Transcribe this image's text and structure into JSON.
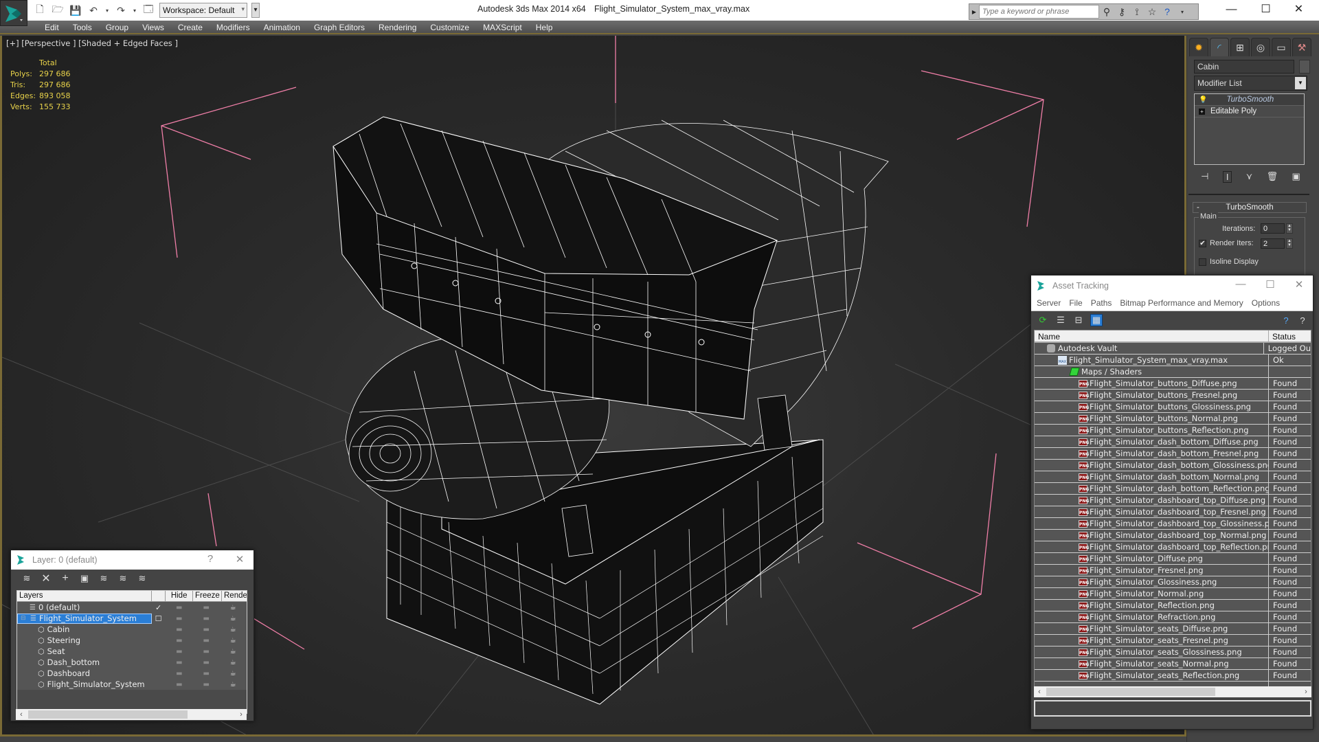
{
  "titlebar": {
    "app_title": "Autodesk 3ds Max  2014 x64",
    "file_name": "Flight_Simulator_System_max_vray.max",
    "workspace": "Workspace: Default",
    "search_placeholder": "Type a keyword or phrase",
    "icons": [
      "new-file-icon",
      "open-folder-icon",
      "save-icon",
      "undo-icon",
      "redo-icon",
      "project-folder-icon"
    ],
    "search_icons": [
      "binoculars-icon",
      "key-icon",
      "satellite-icon",
      "star-icon",
      "help-icon"
    ],
    "controls": {
      "minimize": "—",
      "maximize": "☐",
      "close": "✕"
    }
  },
  "menubar": {
    "items": [
      "Edit",
      "Tools",
      "Group",
      "Views",
      "Create",
      "Modifiers",
      "Animation",
      "Graph Editors",
      "Rendering",
      "Customize",
      "MAXScript",
      "Help"
    ]
  },
  "viewport": {
    "label": "[+] [Perspective ] [Shaded + Edged Faces ]",
    "stats": {
      "header": "Total",
      "rows": [
        {
          "label": "Polys:",
          "value": "297 686"
        },
        {
          "label": "Tris:",
          "value": "297 686"
        },
        {
          "label": "Edges:",
          "value": "893 058"
        },
        {
          "label": "Verts:",
          "value": "155 733"
        }
      ]
    },
    "colors": {
      "stats_text": "#e8d24a",
      "gizmo": "#f07fa8",
      "wire": "#ffffff",
      "border": "#7a6a35"
    }
  },
  "command_panel": {
    "tabs": [
      "create-icon",
      "modify-icon",
      "hierarchy-icon",
      "motion-icon",
      "display-icon",
      "utilities-icon"
    ],
    "object_name": "Cabin",
    "modifier_list": "Modifier List",
    "stack": [
      {
        "label": "TurboSmooth",
        "type": "modifier"
      },
      {
        "label": "Editable Poly",
        "type": "base"
      }
    ],
    "rollout": {
      "title": "TurboSmooth",
      "group": "Main",
      "iterations_label": "Iterations:",
      "iterations_value": "0",
      "render_iters_label": "Render Iters:",
      "render_iters_value": "2",
      "render_iters_checked": true,
      "isoline_label": "Isoline Display",
      "isoline_checked": false
    }
  },
  "asset_tracking": {
    "title": "Asset Tracking",
    "menu": [
      "Server",
      "File",
      "Paths",
      "Bitmap Performance and Memory",
      "Options"
    ],
    "columns": [
      "Name",
      "Status"
    ],
    "rows": [
      {
        "name": "Autodesk Vault",
        "status": "Logged Ou",
        "level": 0,
        "icon": "vault"
      },
      {
        "name": "Flight_Simulator_System_max_vray.max",
        "status": "Ok",
        "level": 1,
        "icon": "max"
      },
      {
        "name": "Maps / Shaders",
        "status": "",
        "level": 2,
        "icon": "maps"
      },
      {
        "name": "Flight_Simulator_buttons_Diffuse.png",
        "status": "Found",
        "level": 3,
        "icon": "png"
      },
      {
        "name": "Flight_Simulator_buttons_Fresnel.png",
        "status": "Found",
        "level": 3,
        "icon": "png"
      },
      {
        "name": "Flight_Simulator_buttons_Glossiness.png",
        "status": "Found",
        "level": 3,
        "icon": "png"
      },
      {
        "name": "Flight_Simulator_buttons_Normal.png",
        "status": "Found",
        "level": 3,
        "icon": "png"
      },
      {
        "name": "Flight_Simulator_buttons_Reflection.png",
        "status": "Found",
        "level": 3,
        "icon": "png"
      },
      {
        "name": "Flight_Simulator_dash_bottom_Diffuse.png",
        "status": "Found",
        "level": 3,
        "icon": "png"
      },
      {
        "name": "Flight_Simulator_dash_bottom_Fresnel.png",
        "status": "Found",
        "level": 3,
        "icon": "png"
      },
      {
        "name": "Flight_Simulator_dash_bottom_Glossiness.png",
        "status": "Found",
        "level": 3,
        "icon": "png"
      },
      {
        "name": "Flight_Simulator_dash_bottom_Normal.png",
        "status": "Found",
        "level": 3,
        "icon": "png"
      },
      {
        "name": "Flight_Simulator_dash_bottom_Reflection.png",
        "status": "Found",
        "level": 3,
        "icon": "png"
      },
      {
        "name": "Flight_Simulator_dashboard_top_Diffuse.png",
        "status": "Found",
        "level": 3,
        "icon": "png"
      },
      {
        "name": "Flight_Simulator_dashboard_top_Fresnel.png",
        "status": "Found",
        "level": 3,
        "icon": "png"
      },
      {
        "name": "Flight_Simulator_dashboard_top_Glossiness.png",
        "status": "Found",
        "level": 3,
        "icon": "png"
      },
      {
        "name": "Flight_Simulator_dashboard_top_Normal.png",
        "status": "Found",
        "level": 3,
        "icon": "png"
      },
      {
        "name": "Flight_Simulator_dashboard_top_Reflection.png",
        "status": "Found",
        "level": 3,
        "icon": "png"
      },
      {
        "name": "Flight_Simulator_Diffuse.png",
        "status": "Found",
        "level": 3,
        "icon": "png"
      },
      {
        "name": "Flight_Simulator_Fresnel.png",
        "status": "Found",
        "level": 3,
        "icon": "png"
      },
      {
        "name": "Flight_Simulator_Glossiness.png",
        "status": "Found",
        "level": 3,
        "icon": "png"
      },
      {
        "name": "Flight_Simulator_Normal.png",
        "status": "Found",
        "level": 3,
        "icon": "png"
      },
      {
        "name": "Flight_Simulator_Reflection.png",
        "status": "Found",
        "level": 3,
        "icon": "png"
      },
      {
        "name": "Flight_Simulator_Refraction.png",
        "status": "Found",
        "level": 3,
        "icon": "png"
      },
      {
        "name": "Flight_Simulator_seats_Diffuse.png",
        "status": "Found",
        "level": 3,
        "icon": "png"
      },
      {
        "name": "Flight_Simulator_seats_Fresnel.png",
        "status": "Found",
        "level": 3,
        "icon": "png"
      },
      {
        "name": "Flight_Simulator_seats_Glossiness.png",
        "status": "Found",
        "level": 3,
        "icon": "png"
      },
      {
        "name": "Flight_Simulator_seats_Normal.png",
        "status": "Found",
        "level": 3,
        "icon": "png"
      },
      {
        "name": "Flight_Simulator_seats_Reflection.png",
        "status": "Found",
        "level": 3,
        "icon": "png"
      }
    ]
  },
  "layers": {
    "title": "Layer: 0 (default)",
    "help": "?",
    "columns": [
      "Layers",
      "",
      "Hide",
      "Freeze",
      "Render"
    ],
    "rows": [
      {
        "name": "0 (default)",
        "type": "layer",
        "level": 0,
        "current": true,
        "selected": false
      },
      {
        "name": "Flight_Simulator_System",
        "type": "layer",
        "level": 0,
        "current": false,
        "selected": true,
        "expanded": true
      },
      {
        "name": "Cabin",
        "type": "object",
        "level": 1
      },
      {
        "name": "Steering",
        "type": "object",
        "level": 1
      },
      {
        "name": "Seat",
        "type": "object",
        "level": 1
      },
      {
        "name": "Dash_bottom",
        "type": "object",
        "level": 1
      },
      {
        "name": "Dashboard",
        "type": "object",
        "level": 1
      },
      {
        "name": "Flight_Simulator_System",
        "type": "object",
        "level": 1
      }
    ]
  }
}
